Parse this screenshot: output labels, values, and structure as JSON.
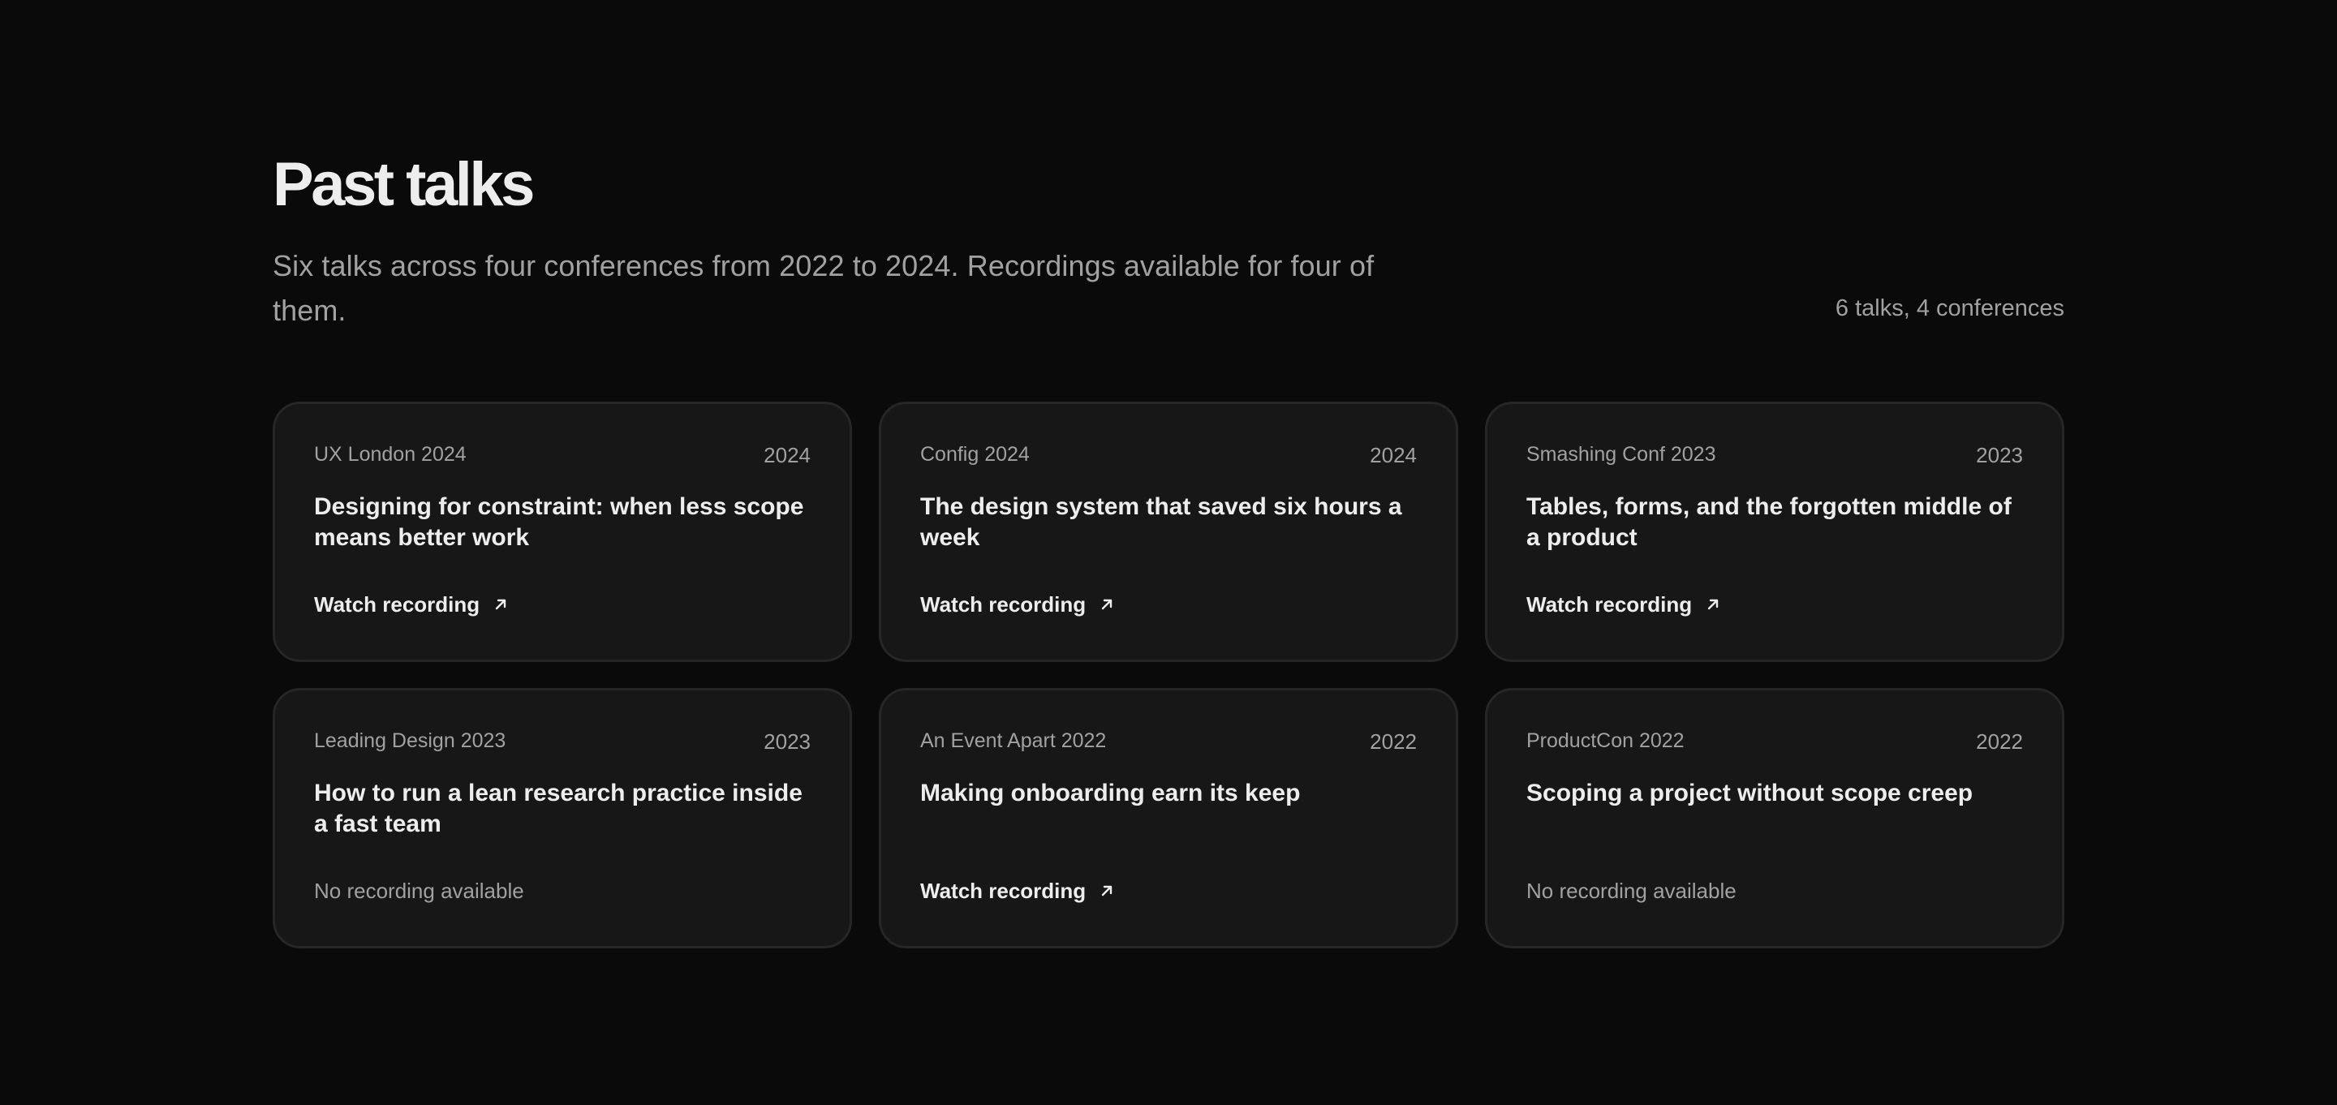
{
  "header": {
    "title": "Past talks",
    "subtitle": "Six talks across four conferences from 2022 to 2024. Recordings available for four of them.",
    "count": "6 talks, 4 conferences"
  },
  "talks": [
    {
      "conference": "UX London 2024",
      "year": "2024",
      "title": "Designing for constraint: when less scope means better work",
      "action": "Watch recording",
      "has_recording": true
    },
    {
      "conference": "Config 2024",
      "year": "2024",
      "title": "The design system that saved six hours a week",
      "action": "Watch recording",
      "has_recording": true
    },
    {
      "conference": "Smashing Conf 2023",
      "year": "2023",
      "title": "Tables, forms, and the forgotten middle of a product",
      "action": "Watch recording",
      "has_recording": true
    },
    {
      "conference": "Leading Design 2023",
      "year": "2023",
      "title": "How to run a lean research practice inside a fast team",
      "action": "No recording available",
      "has_recording": false
    },
    {
      "conference": "An Event Apart 2022",
      "year": "2022",
      "title": "Making onboarding earn its keep",
      "action": "Watch recording",
      "has_recording": true
    },
    {
      "conference": "ProductCon 2022",
      "year": "2022",
      "title": "Scoping a project without scope creep",
      "action": "No recording available",
      "has_recording": false
    }
  ],
  "icons": {
    "recording_link": "arrow-up-right-icon"
  },
  "colors": {
    "background": "#0a0a0a",
    "card": "#171717",
    "card_border": "#262626",
    "text_primary": "#ededed",
    "text_muted": "#a1a1a1"
  }
}
